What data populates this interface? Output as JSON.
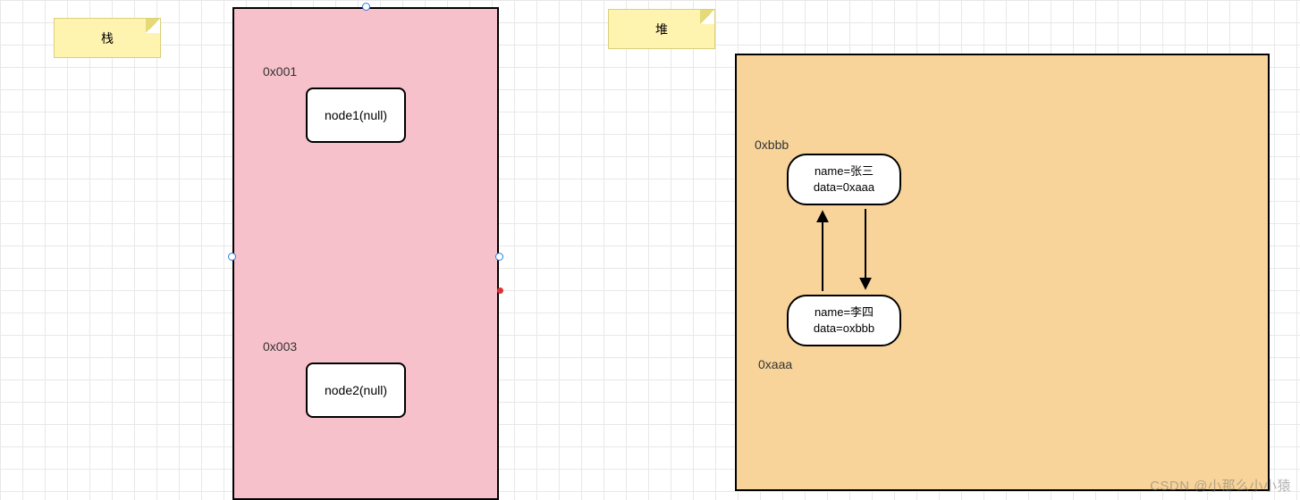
{
  "labels": {
    "stack": "栈",
    "heap": "堆"
  },
  "stack": {
    "addr1": "0x001",
    "node1": "node1(null)",
    "addr2": "0x003",
    "node2": "node2(null)"
  },
  "heap": {
    "addrTop": "0xbbb",
    "objTop": {
      "line1": "name=张三",
      "line2": "data=0xaaa"
    },
    "objBottom": {
      "line1": "name=李四",
      "line2": "data=oxbbb"
    },
    "addrBottom": "0xaaa"
  },
  "watermark": "CSDN @小那么小小猿"
}
